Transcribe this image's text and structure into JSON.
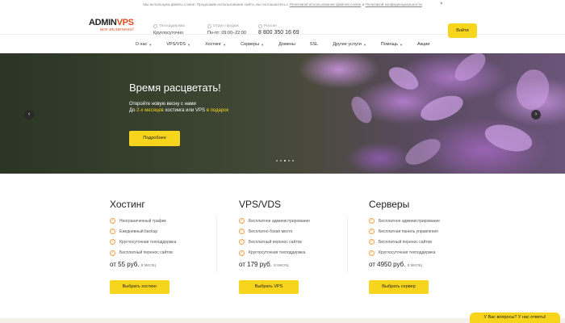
{
  "cookie": {
    "text": "Мы используем файлы cookie. Продолжив использование сайта, вы соглашаетесь с",
    "link1": "Политикой использования файлов cookie",
    "and": "и",
    "link2": "Политикой конфиденциальности",
    "close": "×"
  },
  "header": {
    "logo_word_a": "ADMIN",
    "logo_word_b": "VPS",
    "logo_slogan": "все включено!",
    "support_label": "Техподдержка",
    "support_value": "Круглосуточно",
    "sales_label": "Отдел продаж",
    "sales_value": "Пн-пт: 09:00–22:00",
    "region_label": "Россия",
    "phone": "8 800 350 16 69",
    "login_label": "Войти"
  },
  "nav": {
    "items": [
      {
        "label": "О нас",
        "has_menu": true
      },
      {
        "label": "VPS/VDS",
        "has_menu": true
      },
      {
        "label": "Хостинг",
        "has_menu": true
      },
      {
        "label": "Серверы",
        "has_menu": true
      },
      {
        "label": "Домены",
        "has_menu": false
      },
      {
        "label": "SSL",
        "has_menu": false
      },
      {
        "label": "Другие услуги",
        "has_menu": true
      },
      {
        "label": "Помощь",
        "has_menu": true
      },
      {
        "label": "Акции",
        "has_menu": false
      }
    ],
    "chevron": "▼"
  },
  "hero": {
    "title": "Время расцветать!",
    "line1": "Откройте новую весну с нами",
    "line2_a": "До",
    "line2_hl1": "2-х месяцев",
    "line2_b": "хостинга или VPS",
    "line2_hl2": "в подарок",
    "button": "Подробнее",
    "prev": "‹",
    "next": "›",
    "slide_count": 5,
    "active_slide": 2
  },
  "plans": [
    {
      "title": "Хостинг",
      "features": [
        "Неограниченный трафик",
        "Ежедневный backup",
        "Круглосуточная техподдержка",
        "Бесплатный перенос сайтов"
      ],
      "price": "от 55 руб.",
      "period": "в месяц",
      "button": "Выбрать хостинг"
    },
    {
      "title": "VPS/VDS",
      "features": [
        "Бесплатное администрирование",
        "Бесплатно бэкап место",
        "Бесплатный перенос сайтов",
        "Круглосуточная техподдержка"
      ],
      "price": "от 179 руб.",
      "period": "в месяц",
      "button": "Выбрать VPS"
    },
    {
      "title": "Серверы",
      "features": [
        "Бесплатное администрирование",
        "Бесплатная панель управления",
        "Бесплатный перенос сайтов",
        "Круглосуточная техподдержка"
      ],
      "price": "от 4950 руб.",
      "period": "в месяц",
      "button": "Выбрать сервер"
    }
  ],
  "chat": {
    "label": "У Вас вопросы? У нас ответы!"
  },
  "colors": {
    "accent": "#f7d51d",
    "brand": "#e24a1b",
    "check": "#f0a24a"
  }
}
